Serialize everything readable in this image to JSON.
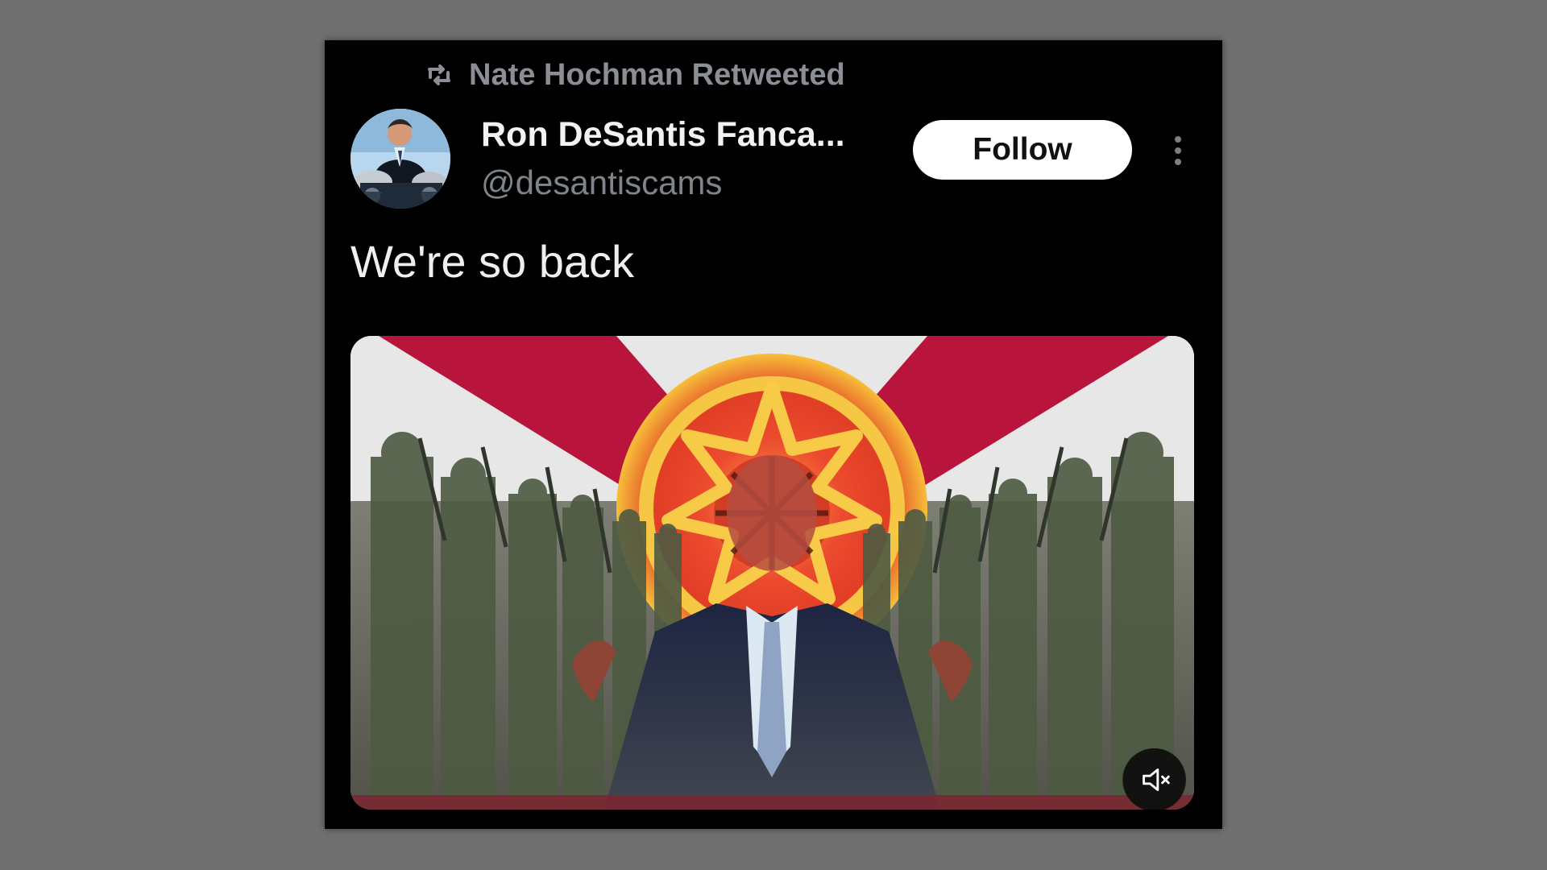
{
  "retweet": {
    "icon": "retweet-icon",
    "label": "Nate Hochman Retweeted"
  },
  "author": {
    "display_name": "Ron DeSantis Fanca...",
    "handle": "@desantiscams",
    "avatar_icon": "profile-photo"
  },
  "actions": {
    "follow_label": "Follow",
    "more_icon": "more-vertical-icon"
  },
  "tweet": {
    "text": "We're so back"
  },
  "media": {
    "type": "video-thumbnail",
    "mute_icon": "muted-speaker-icon"
  },
  "colors": {
    "page_background": "#6f6f6f",
    "card_background": "#000000",
    "muted_text": "#8b8f95",
    "follow_button": "#ffffff",
    "flag_red": "#b9143c"
  }
}
